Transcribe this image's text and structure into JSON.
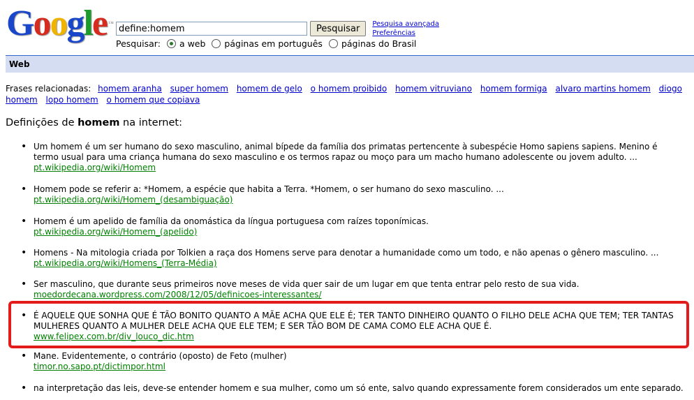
{
  "logo": {
    "letters": [
      "G",
      "o",
      "o",
      "g",
      "l",
      "e"
    ],
    "colors": [
      "#1a47c9",
      "#d62b1f",
      "#f0b400",
      "#1a47c9",
      "#1c9a2c",
      "#d62b1f"
    ],
    "tm": "™"
  },
  "search": {
    "value": "define:homem",
    "button_label": "Pesquisar",
    "advanced_label": "Pesquisa avançada",
    "preferences_label": "Preferências"
  },
  "scope": {
    "label": "Pesquisar:",
    "options": [
      {
        "label": "a web",
        "selected": true
      },
      {
        "label": "páginas em português",
        "selected": false
      },
      {
        "label": "páginas do Brasil",
        "selected": false
      }
    ]
  },
  "tab": {
    "label": "Web"
  },
  "related": {
    "label": "Frases relacionadas:",
    "items": [
      "homem aranha",
      "super homem",
      "homem de gelo",
      "o homem proibido",
      "homem vitruviano",
      "homem formiga",
      "alvaro martins homem",
      "diogo homem",
      "lopo homem",
      "o homem que copiava"
    ]
  },
  "definitions": {
    "heading_prefix": "Definições de ",
    "heading_term": "homem",
    "heading_suffix": " na internet:",
    "items": [
      {
        "text": "Um homem é um ser humano do sexo masculino, animal bípede da família dos primatas pertencente à subespécie Homo sapiens sapiens. Menino é termo usual para uma criança humana do sexo masculino e os termos rapaz ou moço para um macho humano adolescente ou jovem adulto. ...",
        "source": "pt.wikipedia.org/wiki/Homem"
      },
      {
        "text": "Homem pode se referir a: *Homem, a espécie que habita a Terra. *Homem, o ser humano do sexo masculino. ...",
        "source": "pt.wikipedia.org/wiki/Homem_(desambiguação)"
      },
      {
        "text": "Homem é um apelido de família da onomástica da língua portuguesa com raízes toponímicas.",
        "source": "pt.wikipedia.org/wiki/Homem_(apelido)"
      },
      {
        "text": "Homens - Na mitologia criada por Tolkien a raça dos Homens serve para denotar a humanidade como um todo, e não apenas o gênero masculino. ...",
        "source": "pt.wikipedia.org/wiki/Homens_(Terra-Média)"
      },
      {
        "text": "Ser masculino, que durante seus primeiros nove meses de vida quer sair de um lugar em que tenta entrar pelo resto de sua vida.",
        "source": "moedordecana.wordpress.com/2008/12/05/definicoes-interessantes/"
      },
      {
        "text": "É AQUELE QUE SONHA QUE É TÃO BONITO QUANTO A MÃE ACHA QUE ELE É; TER TANTO DINHEIRO QUANTO O FILHO DELE ACHA QUE TEM; TER TANTAS MULHERES QUANTO A MULHER DELE ACHA QUE ELE TEM; E SER TÃO BOM DE CAMA COMO ELE ACHA QUE É.",
        "source": "www.felipex.com.br/div_louco_dic.htm"
      },
      {
        "text": "Mane. Evidentemente, o contrário (oposto) de Feto (mulher)",
        "source": "timor.no.sapo.pt/dictimpor.html"
      },
      {
        "text": "na interpretação das leis, deve-se entender homem e sua mulher, como um só ente, salvo quando expressamente forem considerados um ente separado.",
        "source": ""
      }
    ]
  },
  "highlight_color": "#e31b1b"
}
